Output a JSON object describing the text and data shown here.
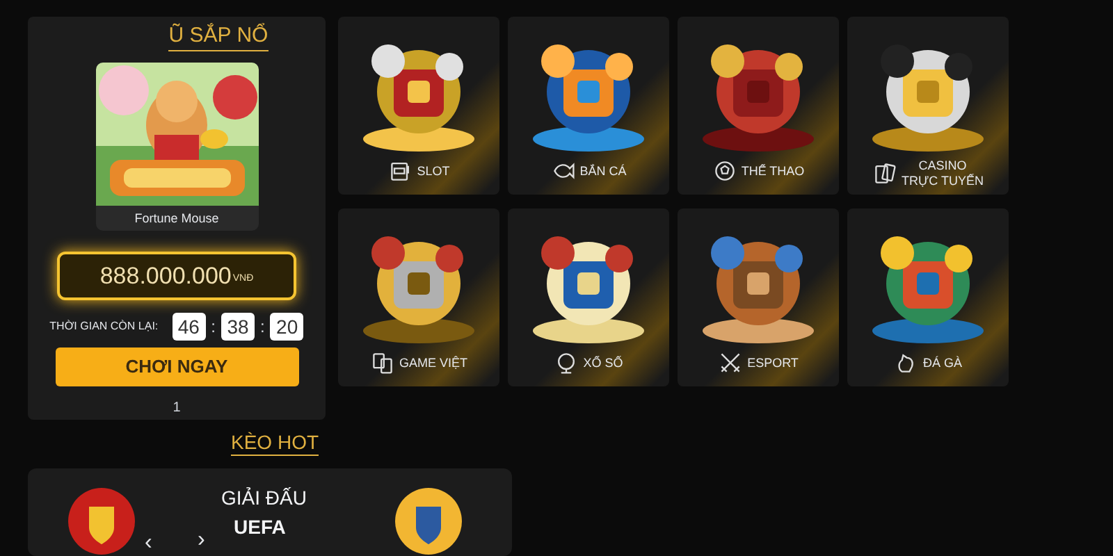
{
  "jackpot_panel": {
    "heading": "Ũ SẮP NỔ",
    "game": {
      "title": "Fortune Mouse"
    },
    "amount": "888.000.000",
    "currency": "VNĐ",
    "timer_label": "THỜI GIAN CÒN LẠI:",
    "timer": [
      "46",
      "38",
      "20"
    ],
    "separator": ":",
    "play_button": "CHƠI NGAY",
    "page": "1"
  },
  "categories": [
    {
      "lines": [
        "SLOT"
      ]
    },
    {
      "lines": [
        "BẮN CÁ"
      ]
    },
    {
      "lines": [
        "THỂ THAO"
      ]
    },
    {
      "lines": [
        "CASINO",
        "TRỰC TUYẾN"
      ]
    },
    {
      "lines": [
        "GAME VIỆT"
      ]
    },
    {
      "lines": [
        "XỔ SỐ"
      ]
    },
    {
      "lines": [
        "ESPORT"
      ]
    },
    {
      "lines": [
        "ĐÁ GÀ"
      ]
    }
  ],
  "hot_odds": {
    "heading": "KÈO HOT",
    "league_label": "GIẢI ĐẤU",
    "league": "UEFA",
    "prev": "‹",
    "next": "›"
  }
}
